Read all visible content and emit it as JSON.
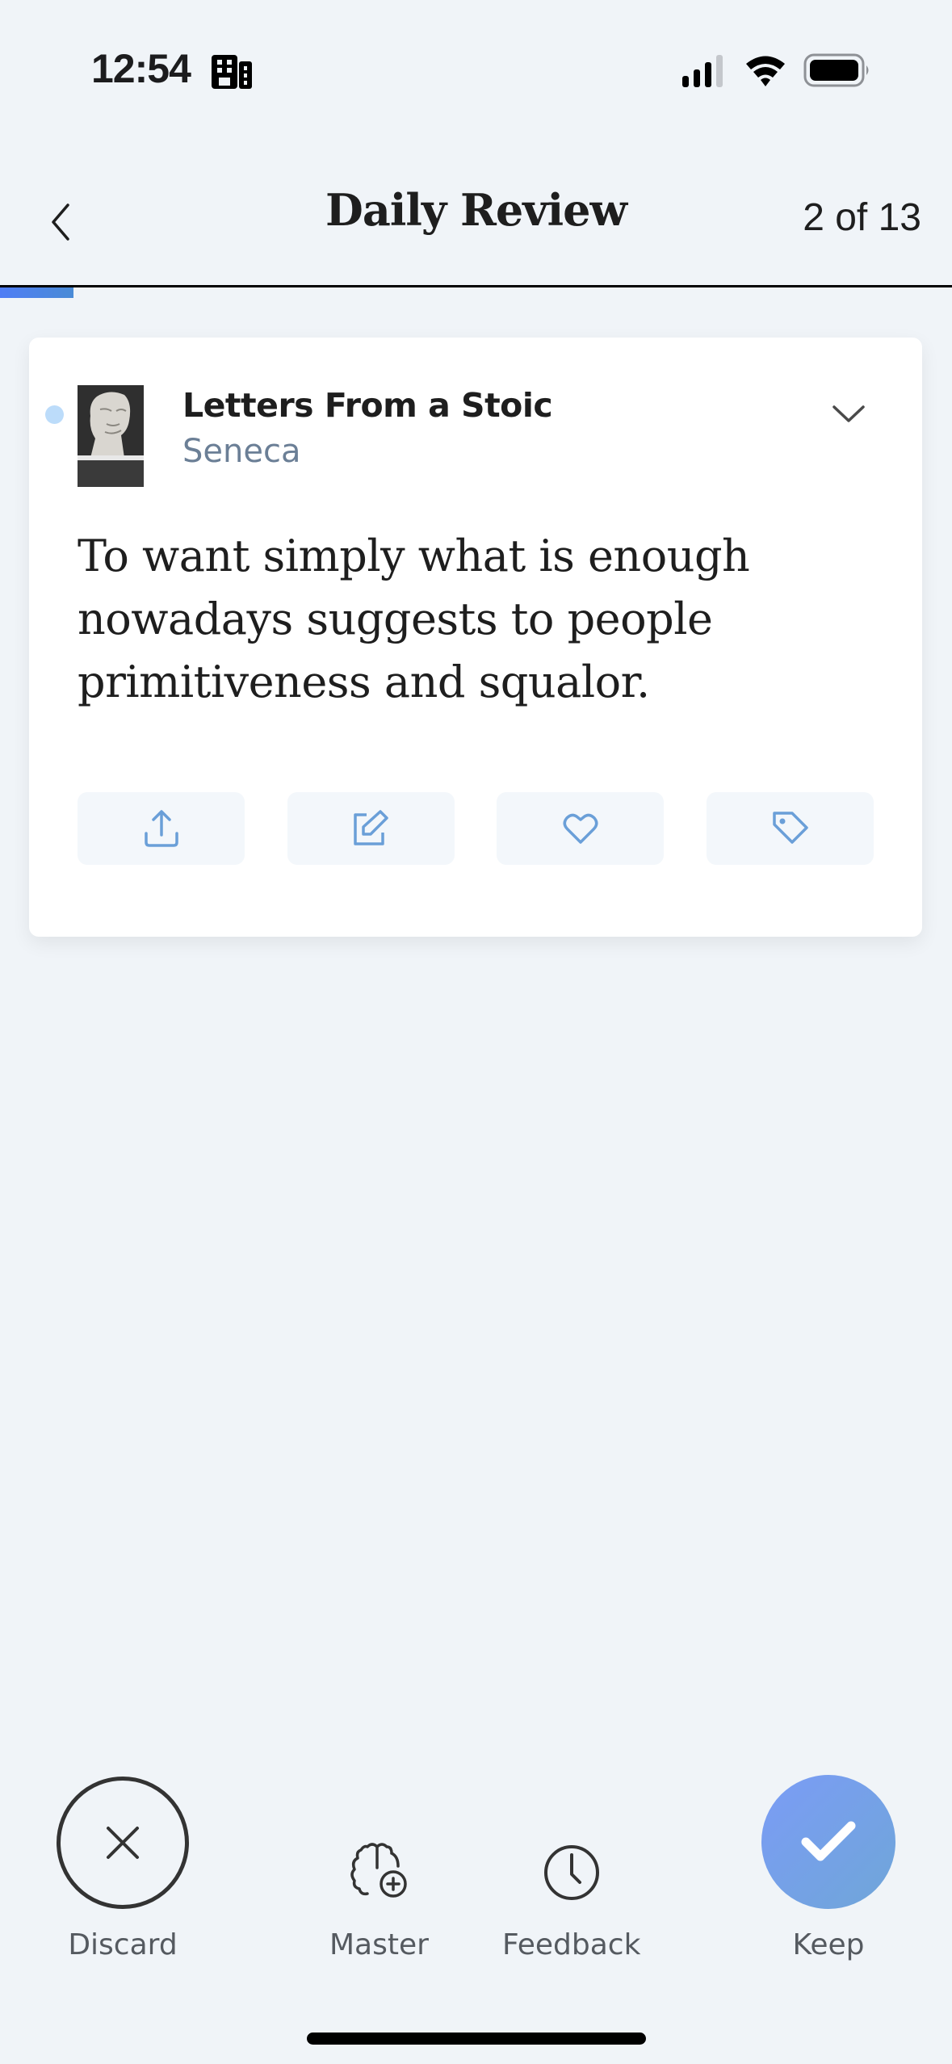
{
  "status_bar": {
    "time": "12:54",
    "icons": [
      "building-icon",
      "signal-icon",
      "wifi-icon",
      "battery-icon"
    ]
  },
  "header": {
    "back_icon": "chevron-left-icon",
    "title": "Daily Review",
    "counter": "2 of 13",
    "progress": {
      "current": 1,
      "total": 13
    }
  },
  "card": {
    "unread": true,
    "book_title": "Letters From a Stoic",
    "author": "Seneca",
    "expand_icon": "chevron-down-icon",
    "quote": "To want simply what is enough nowadays suggests to people primitiveness and squalor.",
    "actions": [
      {
        "name": "share",
        "icon": "share-icon"
      },
      {
        "name": "edit",
        "icon": "edit-icon"
      },
      {
        "name": "favorite",
        "icon": "heart-icon"
      },
      {
        "name": "tag",
        "icon": "tag-icon"
      }
    ],
    "accent_color": "#6a9fd8"
  },
  "bottom_bar": {
    "discard": {
      "label": "Discard",
      "icon": "close-icon"
    },
    "master": {
      "label": "Master",
      "icon": "brain-plus-icon"
    },
    "feedback": {
      "label": "Feedback",
      "icon": "clock-icon"
    },
    "keep": {
      "label": "Keep",
      "icon": "check-icon"
    }
  }
}
